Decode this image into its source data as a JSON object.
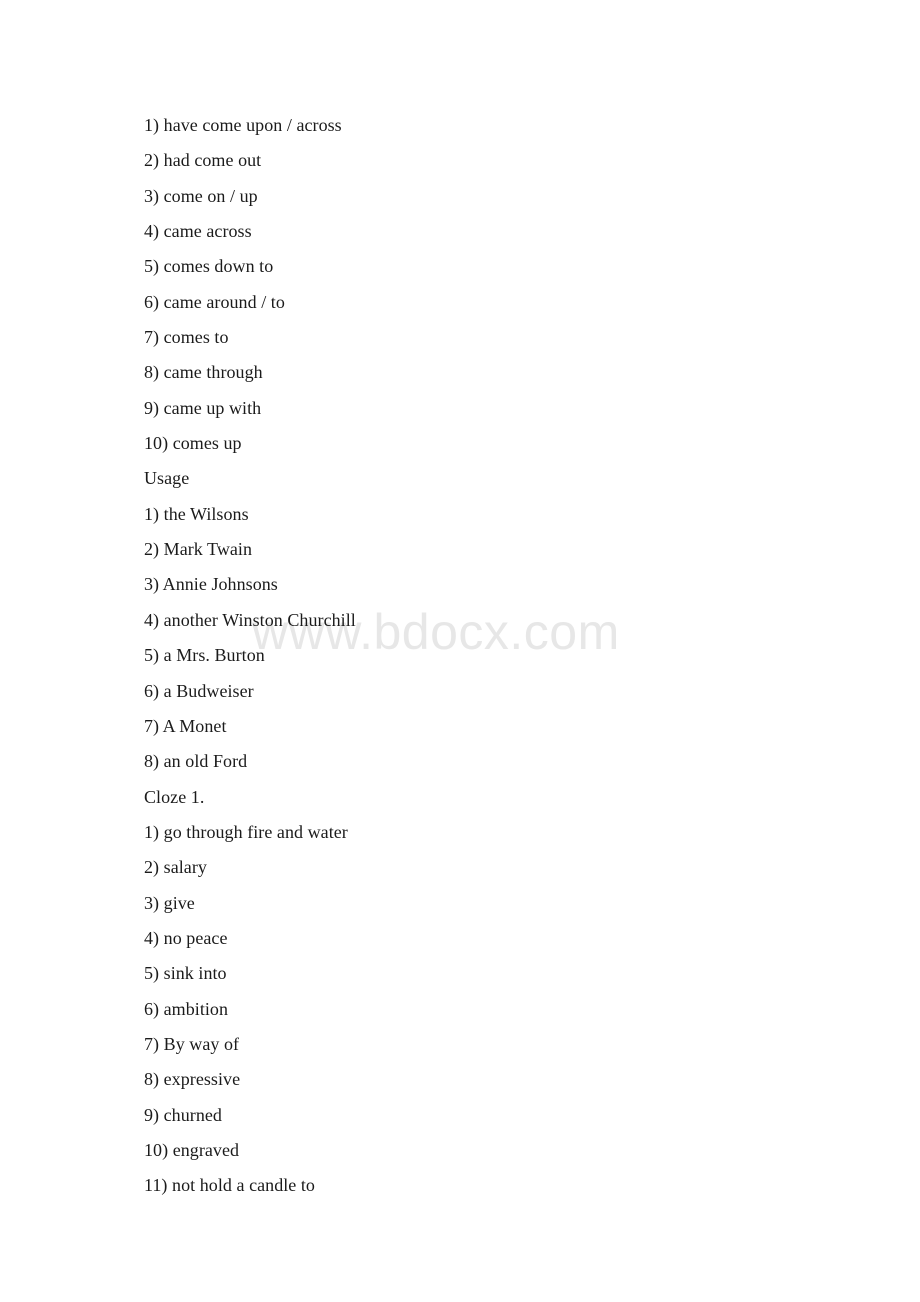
{
  "document": {
    "background_color": "#ffffff",
    "text_color": "#1b1b1b",
    "watermark": {
      "text": "www.bdocx.com",
      "color": "#e7e7e7"
    },
    "lines": [
      {
        "text": "1) have come upon / across"
      },
      {
        "text": "2) had come out"
      },
      {
        "text": "3) come on / up"
      },
      {
        "text": "4) came across"
      },
      {
        "text": "5) comes down to"
      },
      {
        "text": "6) came around / to"
      },
      {
        "text": "7) comes to"
      },
      {
        "text": "8) came through"
      },
      {
        "text": "9) came up with"
      },
      {
        "text": "10) comes up"
      },
      {
        "text": "Usage"
      },
      {
        "text": "1) the Wilsons"
      },
      {
        "text": "2) Mark Twain"
      },
      {
        "text": "3) Annie Johnsons"
      },
      {
        "text": "4) another Winston Churchill"
      },
      {
        "text": "5) a Mrs. Burton"
      },
      {
        "text": "6) a Budweiser"
      },
      {
        "text": "7) A Monet"
      },
      {
        "text": "8) an old Ford"
      },
      {
        "text": "Cloze 1."
      },
      {
        "text": "1) go through fire and water"
      },
      {
        "text": "2) salary"
      },
      {
        "text": "3) give"
      },
      {
        "text": "4) no peace"
      },
      {
        "text": "5) sink into"
      },
      {
        "text": "6) ambition"
      },
      {
        "text": "7) By way of"
      },
      {
        "text": "8) expressive"
      },
      {
        "text": "9) churned"
      },
      {
        "text": "10) engraved"
      },
      {
        "text": "11) not hold a candle to"
      }
    ]
  }
}
